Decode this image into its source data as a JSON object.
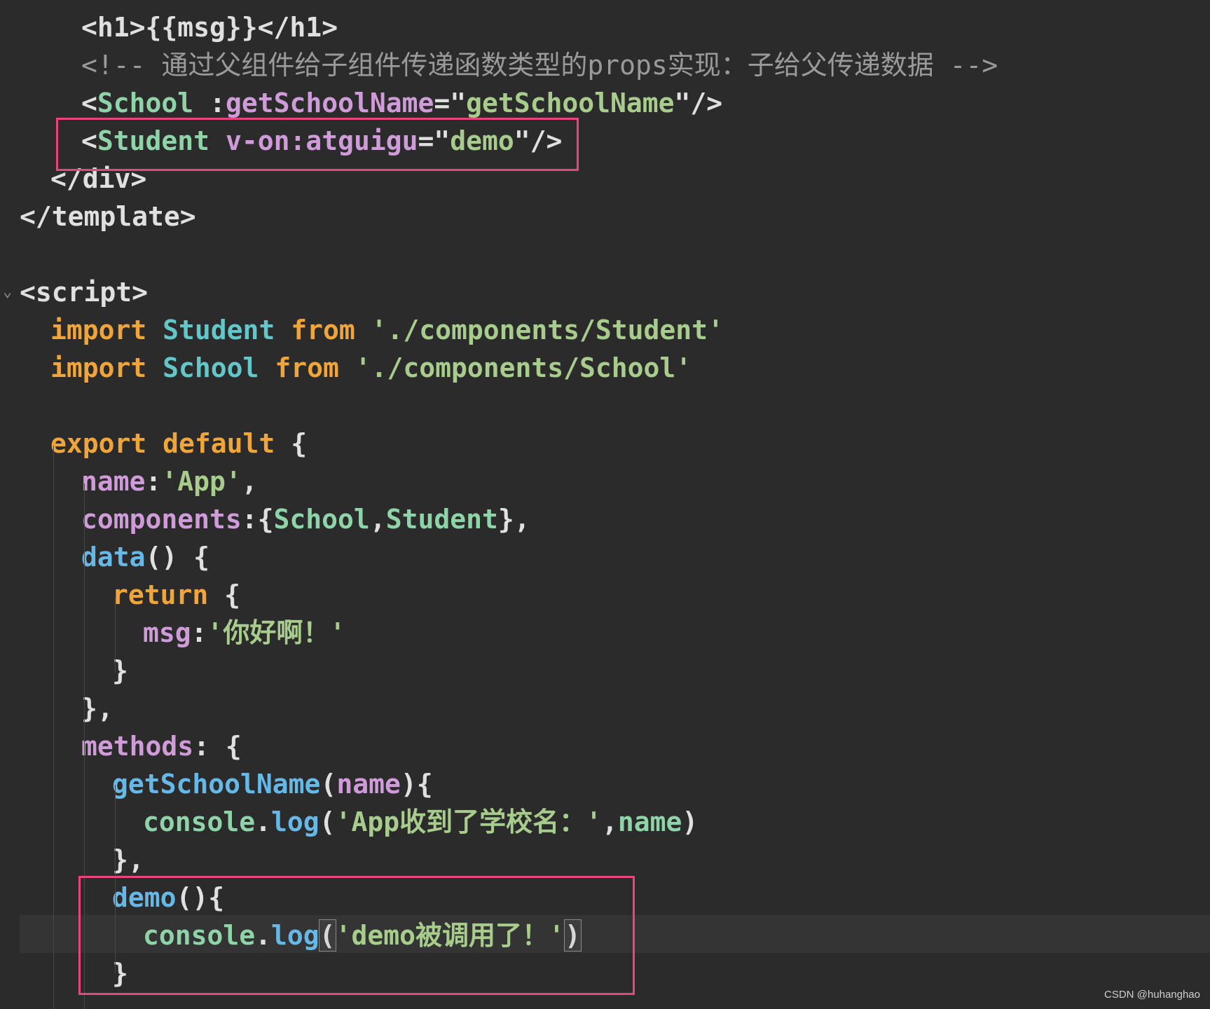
{
  "code_lines": [
    {
      "tokens": [
        [
          "tag",
          "<h1>{{"
        ],
        [
          "plain",
          "msg"
        ],
        [
          "tag",
          "}}</h1>"
        ]
      ]
    },
    {
      "tokens": [
        [
          "cmt",
          "<!-- 通过父组件给子组件传递函数类型的props实现：子给父传递数据 -->"
        ]
      ]
    },
    {
      "tokens": [
        [
          "tag",
          "<"
        ],
        [
          "id",
          "School"
        ],
        [
          "plain",
          " :"
        ],
        [
          "attr",
          "getSchoolName"
        ],
        [
          "plain",
          "=\""
        ],
        [
          "str",
          "getSchoolName"
        ],
        [
          "plain",
          "\"/>"
        ]
      ]
    },
    {
      "tokens": [
        [
          "tag",
          "<"
        ],
        [
          "id",
          "Student"
        ],
        [
          "plain",
          " "
        ],
        [
          "attr",
          "v-on:atguigu"
        ],
        [
          "plain",
          "=\""
        ],
        [
          "str",
          "demo"
        ],
        [
          "plain",
          "\"/>"
        ]
      ]
    },
    {
      "tokens": [
        [
          "tag",
          "</div>"
        ]
      ]
    },
    {
      "tokens": [
        [
          "tag",
          "</template>"
        ]
      ]
    },
    {
      "tokens": []
    },
    {
      "tokens": [
        [
          "tag",
          "<script>"
        ]
      ]
    },
    {
      "tokens": [
        [
          "kw",
          "import"
        ],
        [
          "plain",
          " "
        ],
        [
          "cls",
          "Student"
        ],
        [
          "plain",
          " "
        ],
        [
          "kw",
          "from"
        ],
        [
          "plain",
          " "
        ],
        [
          "str",
          "'./components/Student'"
        ]
      ]
    },
    {
      "tokens": [
        [
          "kw",
          "import"
        ],
        [
          "plain",
          " "
        ],
        [
          "cls",
          "School"
        ],
        [
          "plain",
          " "
        ],
        [
          "kw",
          "from"
        ],
        [
          "plain",
          " "
        ],
        [
          "str",
          "'./components/School'"
        ]
      ]
    },
    {
      "tokens": []
    },
    {
      "tokens": [
        [
          "kw",
          "export"
        ],
        [
          "plain",
          " "
        ],
        [
          "kw",
          "default"
        ],
        [
          "plain",
          " {"
        ]
      ]
    },
    {
      "tokens": [
        [
          "attr",
          "name"
        ],
        [
          "plain",
          ":"
        ],
        [
          "str",
          "'App'"
        ],
        [
          "plain",
          ","
        ]
      ]
    },
    {
      "tokens": [
        [
          "attr",
          "components"
        ],
        [
          "plain",
          ":{"
        ],
        [
          "id",
          "School"
        ],
        [
          "plain",
          ","
        ],
        [
          "id",
          "Student"
        ],
        [
          "plain",
          "},"
        ]
      ]
    },
    {
      "tokens": [
        [
          "func",
          "data"
        ],
        [
          "plain",
          "() {"
        ]
      ]
    },
    {
      "tokens": [
        [
          "kw",
          "return"
        ],
        [
          "plain",
          " {"
        ]
      ]
    },
    {
      "tokens": [
        [
          "attr",
          "msg"
        ],
        [
          "plain",
          ":"
        ],
        [
          "str",
          "'你好啊！'"
        ]
      ]
    },
    {
      "tokens": [
        [
          "plain",
          "}"
        ]
      ]
    },
    {
      "tokens": [
        [
          "plain",
          "},"
        ]
      ]
    },
    {
      "tokens": [
        [
          "attr",
          "methods"
        ],
        [
          "plain",
          ": {"
        ]
      ]
    },
    {
      "tokens": [
        [
          "func",
          "getSchoolName"
        ],
        [
          "plain",
          "("
        ],
        [
          "attr",
          "name"
        ],
        [
          "plain",
          "){"
        ]
      ]
    },
    {
      "tokens": [
        [
          "id",
          "console"
        ],
        [
          "plain",
          "."
        ],
        [
          "func",
          "log"
        ],
        [
          "plain",
          "("
        ],
        [
          "str",
          "'App收到了学校名：'"
        ],
        [
          "plain",
          ","
        ],
        [
          "id",
          "name"
        ],
        [
          "plain",
          ")"
        ]
      ]
    },
    {
      "tokens": [
        [
          "plain",
          "},"
        ]
      ]
    },
    {
      "tokens": [
        [
          "func",
          "demo"
        ],
        [
          "plain",
          "(){"
        ]
      ]
    },
    {
      "tokens": [
        [
          "id",
          "console"
        ],
        [
          "plain",
          "."
        ],
        [
          "func",
          "log"
        ],
        [
          "bracket",
          "("
        ],
        [
          "str",
          "'demo被调用了！'"
        ],
        [
          "bracket",
          ")"
        ]
      ]
    },
    {
      "tokens": [
        [
          "plain",
          "}"
        ]
      ]
    }
  ],
  "colors": {
    "background": "#2b2b2b",
    "highlight_box": "#e8457e",
    "keyword": "#f0a53a",
    "attribute": "#cf9bd9",
    "string": "#a8cc8c",
    "function": "#66b8e6",
    "identifier": "#8fd4a8",
    "class": "#63c6c8",
    "comment": "#9a9a9a"
  },
  "fold_icon": "chevron-down-icon",
  "watermark": "CSDN @huhanghao"
}
